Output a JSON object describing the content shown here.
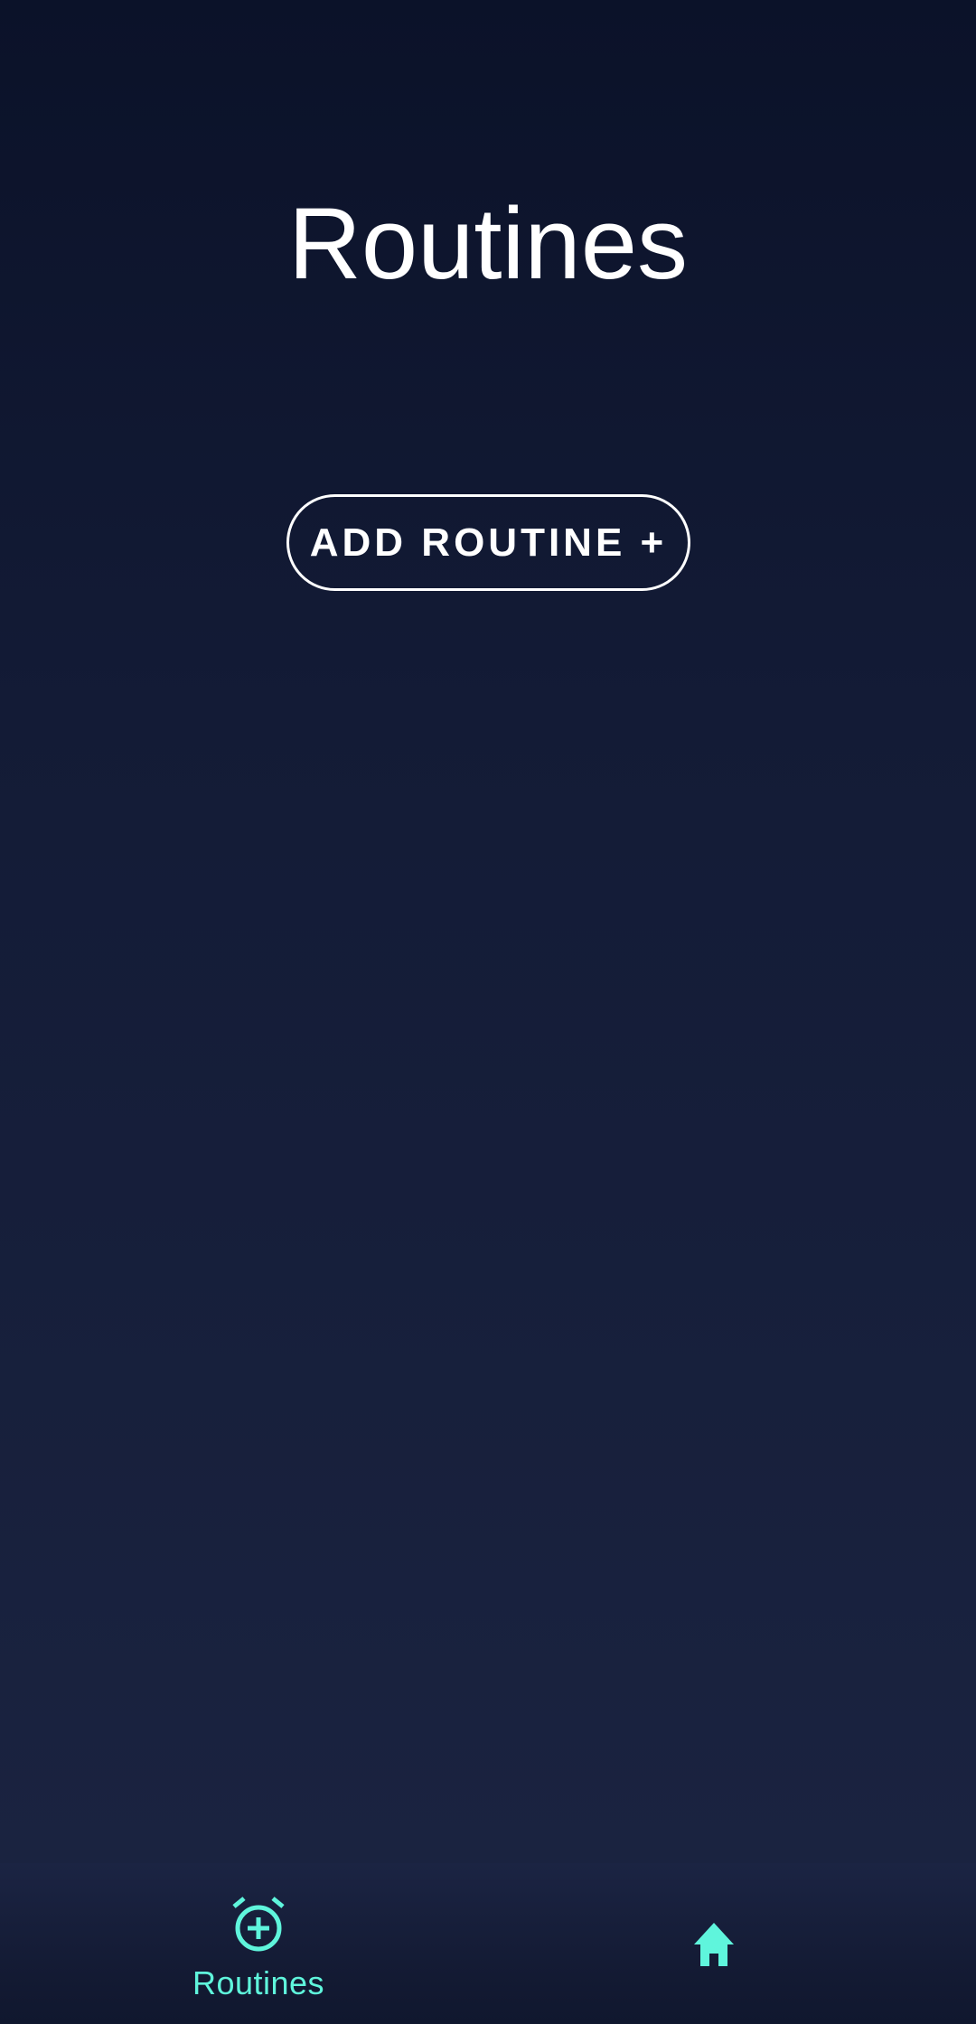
{
  "header": {
    "title": "Routines"
  },
  "main": {
    "add_routine_label": "ADD ROUTINE +"
  },
  "bottom_nav": {
    "items": [
      {
        "label": "Routines",
        "icon": "alarm-add-icon",
        "active": true
      },
      {
        "label": "",
        "icon": "home-icon",
        "active": false
      }
    ]
  },
  "colors": {
    "background_top": "#0b1229",
    "background_bottom": "#1b2443",
    "accent": "#5ff5dc",
    "text": "#ffffff"
  }
}
